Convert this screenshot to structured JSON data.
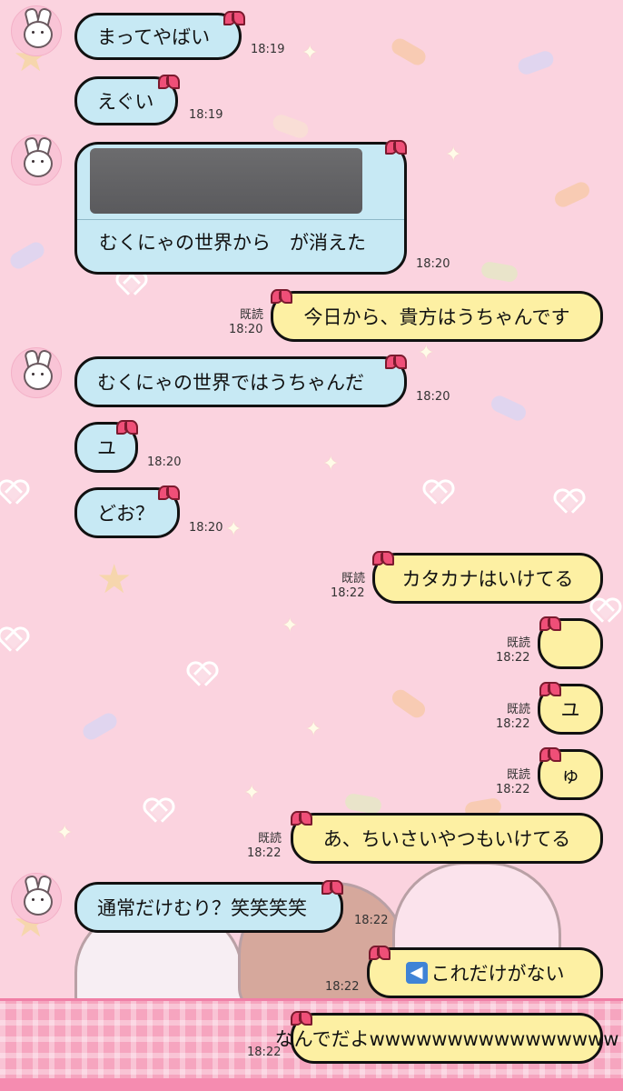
{
  "messages": [
    {
      "text": "まってやばい",
      "time": "18:19"
    },
    {
      "text": "えぐい",
      "time": "18:19"
    },
    {
      "text": "むくにゃの世界から　が消えた",
      "time": "18:20",
      "has_image": true
    },
    {
      "text": "今日から、貴方はうちゃんです",
      "time": "18:20",
      "read": "既読"
    },
    {
      "text": "むくにゃの世界ではうちゃんだ",
      "time": "18:20"
    },
    {
      "text": "ユ",
      "time": "18:20"
    },
    {
      "text": "どお？",
      "time": "18:20"
    },
    {
      "text": "カタカナはいけてる",
      "time": "18:22",
      "read": "既読"
    },
    {
      "text": "",
      "time": "18:22",
      "read": "既読"
    },
    {
      "text": "ユ",
      "time": "18:22",
      "read": "既読"
    },
    {
      "text": "ゅ",
      "time": "18:22",
      "read": "既読"
    },
    {
      "text": "あ、ちいさいやつもいけてる",
      "time": "18:22",
      "read": "既読"
    },
    {
      "text": "通常だけむり？笑笑笑笑",
      "time": "18:22"
    },
    {
      "text": "これだけがない",
      "time": "18:22",
      "icon": "left-arrow-icon"
    },
    {
      "text": "なんでだよwwwwwwwwwwwwwwww",
      "time": "18:22"
    }
  ],
  "colors": {
    "background": "#fbd3df",
    "incoming_bubble": "#c7e9f4",
    "outgoing_bubble": "#fdf0a3",
    "bow": "#ef4f78"
  }
}
